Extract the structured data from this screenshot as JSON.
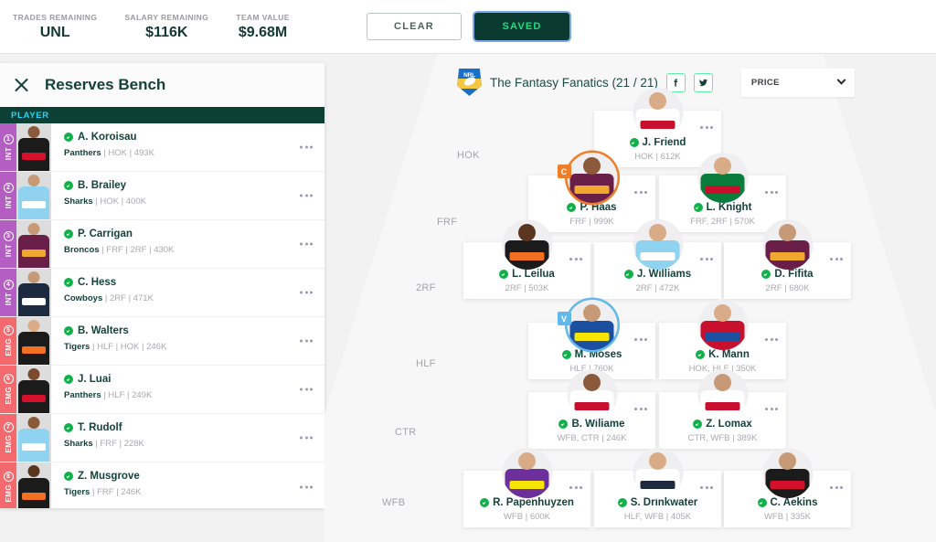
{
  "topbar": {
    "stats": [
      {
        "label": "TRADES REMAINING",
        "value": "UNL"
      },
      {
        "label": "SALARY REMAINING",
        "value": "$116K"
      },
      {
        "label": "TEAM VALUE",
        "value": "$9.68M"
      }
    ],
    "clear_label": "CLEAR",
    "saved_label": "SAVED"
  },
  "sidebar": {
    "title": "Reserves Bench",
    "close_icon": "close-icon",
    "column_header": "PLAYER",
    "rows": [
      {
        "slot": "INT",
        "num": "1",
        "name": "A. Koroisau",
        "team": "Panthers",
        "meta": " | HOK | 493K",
        "jersey": "#1b1b1b",
        "band": "#d4102a",
        "skin": "#8a5a3a"
      },
      {
        "slot": "INT",
        "num": "2",
        "name": "B. Brailey",
        "team": "Sharks",
        "meta": " | HOK | 400K",
        "jersey": "#8fd3f0",
        "band": "#ffffff",
        "skin": "#c79a77"
      },
      {
        "slot": "INT",
        "num": "3",
        "name": "P. Carrigan",
        "team": "Broncos",
        "meta": " | FRF | 2RF | 430K",
        "jersey": "#6a1f49",
        "band": "#f0a92e",
        "skin": "#c79a77"
      },
      {
        "slot": "INT",
        "num": "4",
        "name": "C. Hess",
        "team": "Cowboys",
        "meta": " | 2RF | 471K",
        "jersey": "#1c2b3f",
        "band": "#ffffff",
        "skin": "#c79a77"
      },
      {
        "slot": "EMG",
        "num": "5",
        "name": "B. Walters",
        "team": "Tigers",
        "meta": " | HLF | HOK | 246K",
        "jersey": "#1b1b1b",
        "band": "#f37021",
        "skin": "#d9ab86"
      },
      {
        "slot": "EMG",
        "num": "6",
        "name": "J. Luai",
        "team": "Panthers",
        "meta": " | HLF | 249K",
        "jersey": "#1b1b1b",
        "band": "#d4102a",
        "skin": "#7a4b2e"
      },
      {
        "slot": "EMG",
        "num": "7",
        "name": "T. Rudolf",
        "team": "Sharks",
        "meta": " | FRF | 228K",
        "jersey": "#8fd3f0",
        "band": "#ffffff",
        "skin": "#8a5a3a"
      },
      {
        "slot": "EMG",
        "num": "8",
        "name": "Z. Musgrove",
        "team": "Tigers",
        "meta": " | FRF | 246K",
        "jersey": "#1b1b1b",
        "band": "#f37021",
        "skin": "#5a3520"
      }
    ]
  },
  "field": {
    "team_title": "The Fantasy Fanatics (21 / 21)",
    "logo_text": "NRL",
    "facebook_icon": "facebook-icon",
    "twitter_icon": "twitter-icon",
    "sort_label": "PRICE",
    "position_labels": [
      "HOK",
      "FRF",
      "2RF",
      "HLF",
      "CTR",
      "WFB"
    ],
    "players": [
      {
        "name": "J. Friend",
        "meta": "HOK | 612K",
        "role": "",
        "jersey": "#ffffff",
        "band": "#c8102e",
        "skin": "#d9ab86"
      },
      {
        "name": "P. Haas",
        "meta": "FRF | 999K",
        "role": "C",
        "jersey": "#6a1f49",
        "band": "#f0a92e",
        "skin": "#8a5a3a"
      },
      {
        "name": "L. Knight",
        "meta": "FRF, 2RF | 570K",
        "role": "",
        "jersey": "#0a7d3c",
        "band": "#c8102e",
        "skin": "#d9ab86"
      },
      {
        "name": "L. Leilua",
        "meta": "2RF | 503K",
        "role": "",
        "jersey": "#1b1b1b",
        "band": "#f37021",
        "skin": "#5a3520"
      },
      {
        "name": "J. Williams",
        "meta": "2RF | 472K",
        "role": "",
        "jersey": "#8fd3f0",
        "band": "#ffffff",
        "skin": "#d9ab86"
      },
      {
        "name": "D. Fifita",
        "meta": "2RF | 680K",
        "role": "",
        "jersey": "#6a1f49",
        "band": "#f0a92e",
        "skin": "#c79a77"
      },
      {
        "name": "M. Moses",
        "meta": "HLF | 760K",
        "role": "V",
        "jersey": "#1b4fa0",
        "band": "#f6e500",
        "skin": "#c79a77"
      },
      {
        "name": "K. Mann",
        "meta": "HOK, HLF | 350K",
        "role": "",
        "jersey": "#c8102e",
        "band": "#1b4fa0",
        "skin": "#d9ab86"
      },
      {
        "name": "B. Wiliame",
        "meta": "WFB, CTR | 246K",
        "role": "",
        "jersey": "#ffffff",
        "band": "#c8102e",
        "skin": "#8a5a3a"
      },
      {
        "name": "Z. Lomax",
        "meta": "CTR, WFB | 389K",
        "role": "",
        "jersey": "#ffffff",
        "band": "#c8102e",
        "skin": "#c79a77"
      },
      {
        "name": "R. Papenhuyzen",
        "meta": "WFB | 600K",
        "role": "",
        "jersey": "#6d2f9c",
        "band": "#f6e500",
        "skin": "#d9ab86"
      },
      {
        "name": "S. Drinkwater",
        "meta": "HLF, WFB | 405K",
        "role": "",
        "jersey": "#ffffff",
        "band": "#1c2b3f",
        "skin": "#d9ab86"
      },
      {
        "name": "C. Aekins",
        "meta": "WFB | 335K",
        "role": "",
        "jersey": "#1b1b1b",
        "band": "#d4102a",
        "skin": "#c79a77"
      }
    ]
  }
}
